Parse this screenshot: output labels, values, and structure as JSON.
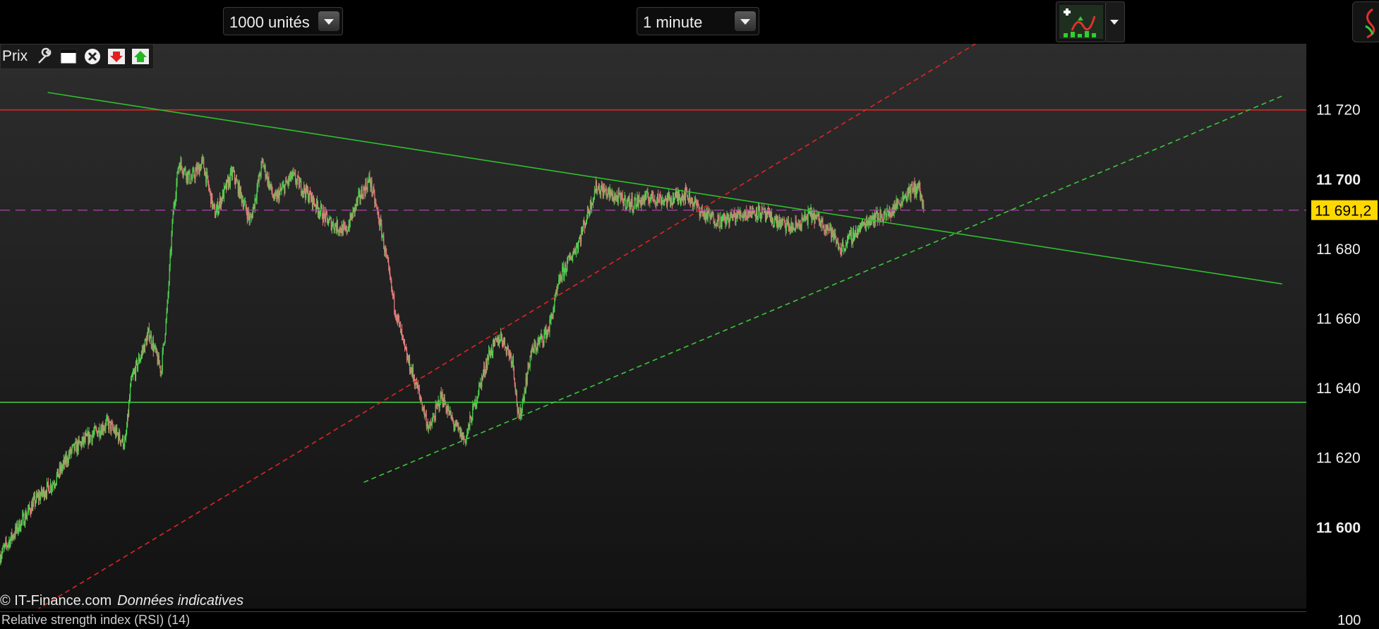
{
  "toolbar": {
    "units_select": "1000 unités",
    "interval_select": "1 minute"
  },
  "panel": {
    "title": "Prix",
    "icons": [
      "wrench-icon",
      "window-icon",
      "close-icon",
      "download-icon",
      "upload-icon"
    ]
  },
  "footer": {
    "copyright": "© IT-Finance.com",
    "disclaimer": "Données indicatives"
  },
  "bottom_panel": {
    "title": "Relative strength index (RSI) (14)",
    "axis_value": "100"
  },
  "colors": {
    "up_candle": "#4fd34f",
    "down_candle": "#e07a7a",
    "resistance_line": "#e02424",
    "support_line": "#3cc63c",
    "trend_line": "#2fbf2f",
    "last_price_badge": "#ffd800",
    "last_price_line": "#a040a0"
  },
  "chart_data": {
    "type": "candlestick",
    "y_ticks": [
      "11 720",
      "11 700",
      "11 680",
      "11 660",
      "11 640",
      "11 620",
      "11 600"
    ],
    "y_tick_values": [
      11720,
      11700,
      11680,
      11660,
      11640,
      11620,
      11600
    ],
    "ylim": [
      11574,
      11739
    ],
    "last_price_label": "11 691,2",
    "last_price": 11691.2,
    "horizontal_lines": [
      {
        "name": "resistance",
        "value": 11720,
        "color": "#e02424"
      },
      {
        "name": "support",
        "value": 11636,
        "color": "#3cc63c"
      }
    ],
    "trend_lines": [
      {
        "name": "descending",
        "style": "solid",
        "color": "#2fbf2f",
        "x": [
          8,
          215
        ],
        "y": [
          11725,
          11670
        ]
      },
      {
        "name": "ascending-red",
        "style": "dashed",
        "color": "#e02424",
        "x": [
          0,
          181
        ],
        "y": [
          11570,
          11757
        ]
      },
      {
        "name": "ascending-green",
        "style": "dashed",
        "color": "#3cc63c",
        "x": [
          61,
          215
        ],
        "y": [
          11613,
          11724
        ]
      }
    ],
    "path": [
      [
        0,
        11592
      ],
      [
        3,
        11600
      ],
      [
        6,
        11608
      ],
      [
        9,
        11613
      ],
      [
        12,
        11622
      ],
      [
        15,
        11626
      ],
      [
        18,
        11630
      ],
      [
        21,
        11624
      ],
      [
        22,
        11642
      ],
      [
        25,
        11656
      ],
      [
        27,
        11645
      ],
      [
        28,
        11662
      ],
      [
        29,
        11690
      ],
      [
        30,
        11705
      ],
      [
        32,
        11700
      ],
      [
        34,
        11705
      ],
      [
        36,
        11690
      ],
      [
        39,
        11702
      ],
      [
        42,
        11688
      ],
      [
        44,
        11705
      ],
      [
        46,
        11694
      ],
      [
        49,
        11701
      ],
      [
        52,
        11695
      ],
      [
        55,
        11688
      ],
      [
        58,
        11685
      ],
      [
        60,
        11694
      ],
      [
        62,
        11700
      ],
      [
        64,
        11685
      ],
      [
        66,
        11665
      ],
      [
        68,
        11650
      ],
      [
        70,
        11640
      ],
      [
        72,
        11628
      ],
      [
        74,
        11638
      ],
      [
        76,
        11630
      ],
      [
        78,
        11625
      ],
      [
        80,
        11638
      ],
      [
        82,
        11650
      ],
      [
        84,
        11655
      ],
      [
        86,
        11648
      ],
      [
        87,
        11630
      ],
      [
        89,
        11650
      ],
      [
        92,
        11657
      ],
      [
        94,
        11672
      ],
      [
        97,
        11682
      ],
      [
        100,
        11698
      ],
      [
        103,
        11695
      ],
      [
        106,
        11693
      ],
      [
        109,
        11695
      ],
      [
        112,
        11694
      ],
      [
        115,
        11696
      ],
      [
        118,
        11690
      ],
      [
        121,
        11688
      ],
      [
        124,
        11690
      ],
      [
        127,
        11691
      ],
      [
        130,
        11688
      ],
      [
        133,
        11686
      ],
      [
        136,
        11690
      ],
      [
        139,
        11686
      ],
      [
        141,
        11680
      ],
      [
        143,
        11684
      ],
      [
        146,
        11689
      ],
      [
        149,
        11690
      ],
      [
        152,
        11696
      ],
      [
        154,
        11698
      ],
      [
        155,
        11691
      ]
    ]
  }
}
